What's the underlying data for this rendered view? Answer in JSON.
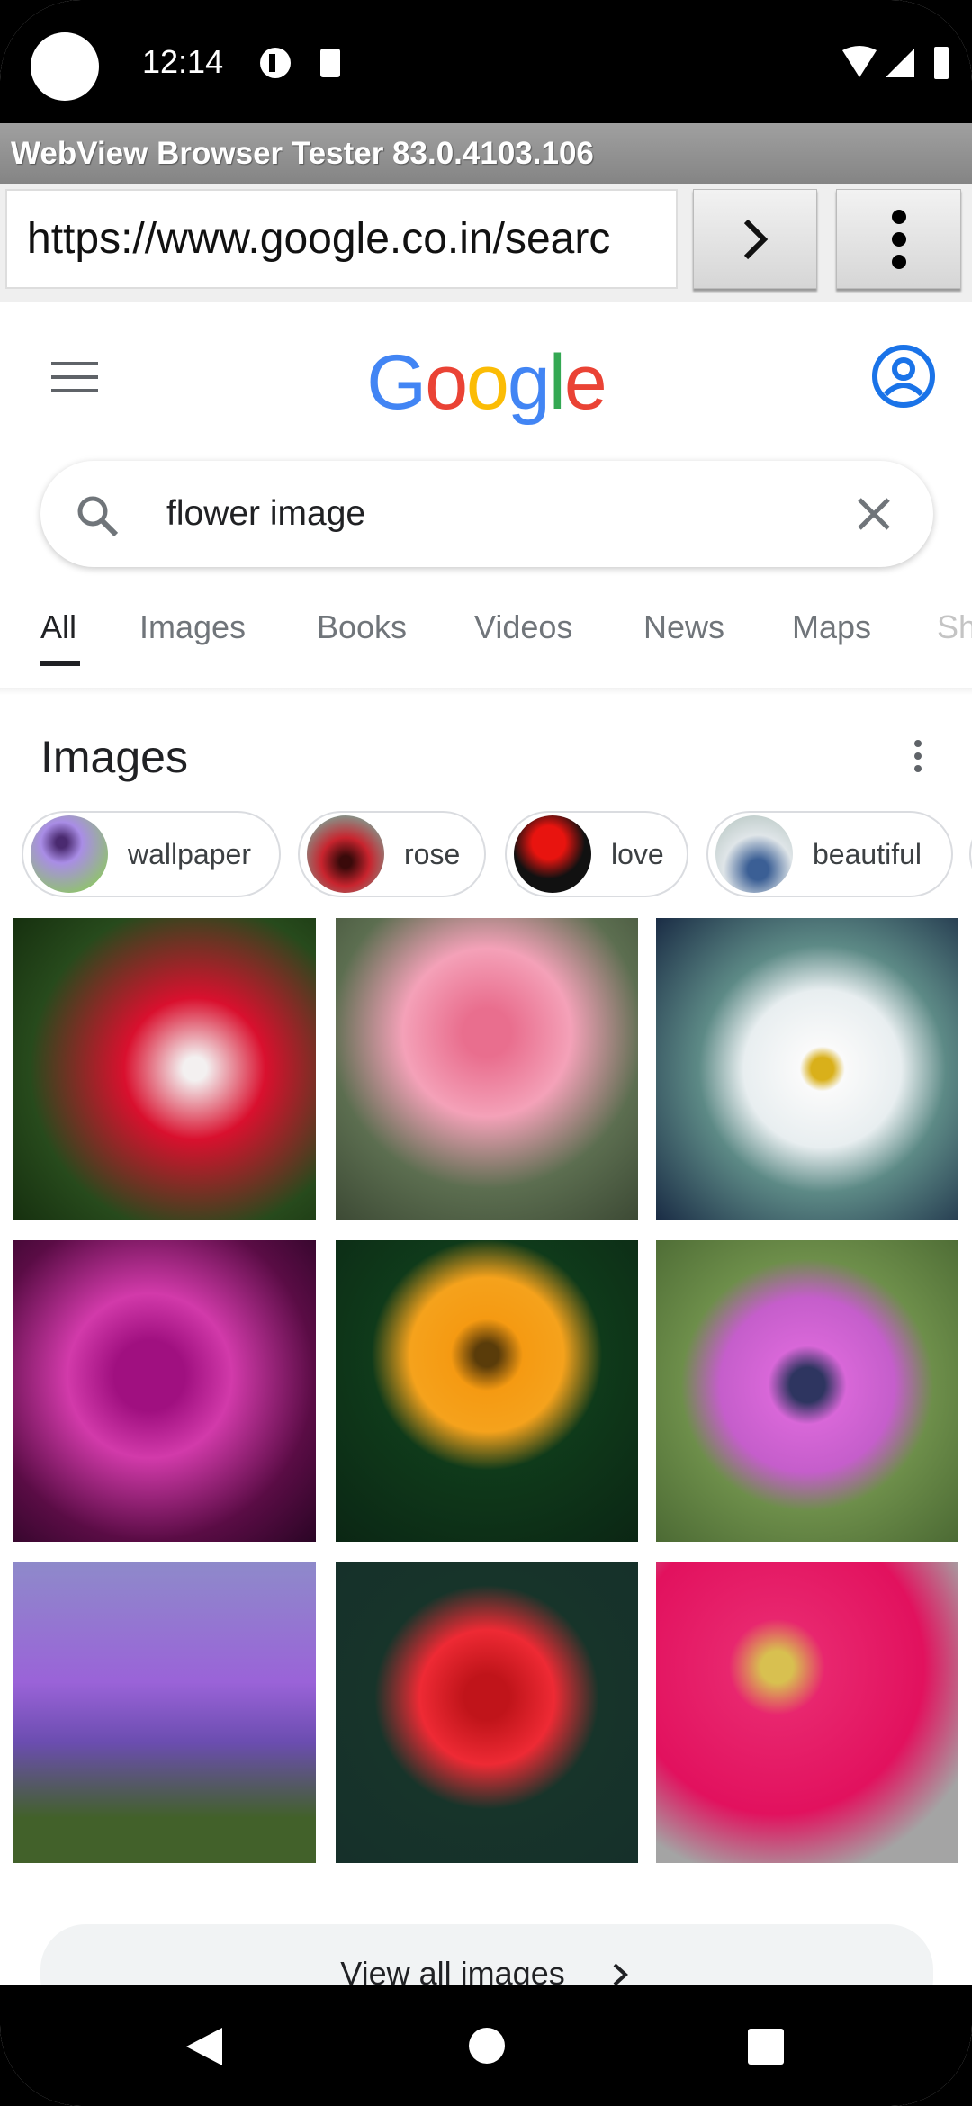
{
  "status": {
    "time": "12:14"
  },
  "browser": {
    "title": "WebView Browser Tester 83.0.4103.106",
    "url": "https://www.google.co.in/searc"
  },
  "google": {
    "logo": "Google",
    "logo_colors": [
      "#4285f4",
      "#ea4335",
      "#fbbc05",
      "#4285f4",
      "#34a853",
      "#ea4335"
    ],
    "query": "flower image"
  },
  "tabs": [
    "All",
    "Images",
    "Books",
    "Videos",
    "News",
    "Maps",
    "Sh"
  ],
  "images_section": {
    "title": "Images",
    "chips": [
      "wallpaper",
      "rose",
      "love",
      "beautiful"
    ],
    "view_all": "View all images"
  },
  "icons": [
    "menu-icon",
    "account-icon",
    "search-icon",
    "clear-icon",
    "more-vert-icon",
    "chevron-right-icon",
    "back-icon",
    "home-icon",
    "recents-icon"
  ]
}
